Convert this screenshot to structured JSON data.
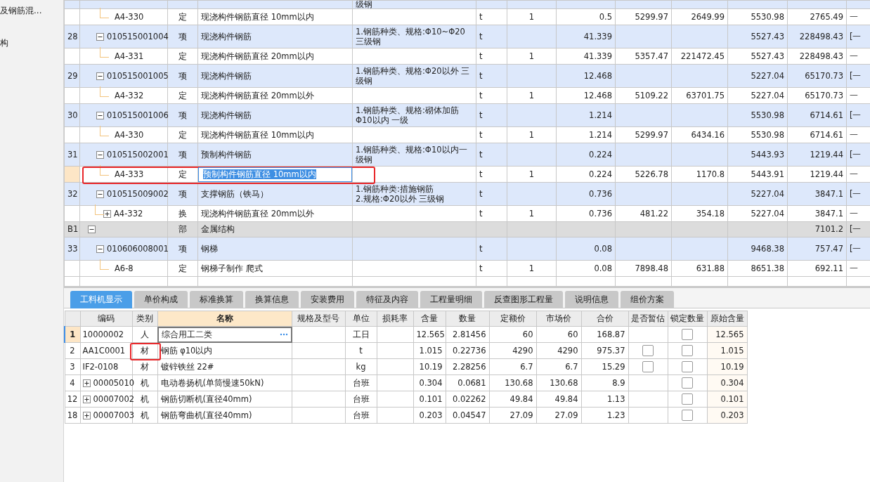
{
  "sidebar": {
    "items": [
      {
        "label": "及钢筋混..."
      },
      {
        "label": "构"
      }
    ]
  },
  "grid": {
    "rows": [
      {
        "kind": "clipped",
        "spec": [
          "级钢"
        ],
        "children": [
          {
            "kind": "quota",
            "code": "A4-330",
            "type": "定",
            "name": "现浇构件钢筋直径 10mm以内",
            "unit": "t",
            "factor": "1",
            "qty": "0.5",
            "base_price": "5299.97",
            "base_total": "2649.99",
            "unit_price": "5530.98",
            "total": "2765.49",
            "extra": "一",
            "selected": false
          }
        ]
      },
      {
        "kind": "item",
        "no": "28",
        "code": "010515001004",
        "expanded": true,
        "type": "项",
        "name": "现浇构件钢筋",
        "spec": [
          "1.钢筋种类、规格:Φ10~Φ20",
          "三级钢"
        ],
        "unit": "t",
        "qty": "41.339",
        "unit_price": "5527.43",
        "total": "228498.43",
        "extra": "[一",
        "children": [
          {
            "kind": "quota",
            "code": "A4-331",
            "type": "定",
            "name": "现浇构件钢筋直径 20mm以内",
            "unit": "t",
            "factor": "1",
            "qty": "41.339",
            "base_price": "5357.47",
            "base_total": "221472.45",
            "unit_price": "5527.43",
            "total": "228498.43",
            "extra": "一",
            "selected": false
          }
        ]
      },
      {
        "kind": "item",
        "no": "29",
        "code": "010515001005",
        "expanded": true,
        "type": "项",
        "name": "现浇构件钢筋",
        "spec": [
          "1.钢筋种类、规格:Φ20以外 三",
          "级钢"
        ],
        "unit": "t",
        "qty": "12.468",
        "unit_price": "5227.04",
        "total": "65170.73",
        "extra": "[一",
        "children": [
          {
            "kind": "quota",
            "code": "A4-332",
            "type": "定",
            "name": "现浇构件钢筋直径 20mm以外",
            "unit": "t",
            "factor": "1",
            "qty": "12.468",
            "base_price": "5109.22",
            "base_total": "63701.75",
            "unit_price": "5227.04",
            "total": "65170.73",
            "extra": "一",
            "selected": false
          }
        ]
      },
      {
        "kind": "item",
        "no": "30",
        "code": "010515001006",
        "expanded": true,
        "type": "项",
        "name": "现浇构件钢筋",
        "spec": [
          "1.钢筋种类、规格:砌体加筋",
          "Φ10以内 一级"
        ],
        "unit": "t",
        "qty": "1.214",
        "unit_price": "5530.98",
        "total": "6714.61",
        "extra": "[一",
        "children": [
          {
            "kind": "quota",
            "code": "A4-330",
            "type": "定",
            "name": "现浇构件钢筋直径 10mm以内",
            "unit": "t",
            "factor": "1",
            "qty": "1.214",
            "base_price": "5299.97",
            "base_total": "6434.16",
            "unit_price": "5530.98",
            "total": "6714.61",
            "extra": "一",
            "selected": false
          }
        ]
      },
      {
        "kind": "item",
        "no": "31",
        "code": "010515002001",
        "expanded": true,
        "type": "项",
        "name": "预制构件钢筋",
        "spec": [
          "1.钢筋种类、规格:Φ10以内一",
          "级钢"
        ],
        "unit": "t",
        "qty": "0.224",
        "unit_price": "5443.93",
        "total": "1219.44",
        "extra": "[一",
        "children": [
          {
            "kind": "quota",
            "code": "A4-333",
            "type": "定",
            "name": "预制构件钢筋直径 10mm以内",
            "unit": "t",
            "factor": "1",
            "qty": "0.224",
            "base_price": "5226.78",
            "base_total": "1170.8",
            "unit_price": "5443.91",
            "total": "1219.44",
            "extra": "一",
            "selected": true,
            "highlighted": true
          }
        ]
      },
      {
        "kind": "item",
        "no": "32",
        "code": "010515009002",
        "expanded": true,
        "type": "项",
        "name": "支撑钢筋（铁马）",
        "spec": [
          "1.钢筋种类:措施钢筋",
          "2.规格:Φ20以外 三级钢"
        ],
        "unit": "t",
        "qty": "0.736",
        "unit_price": "5227.04",
        "total": "3847.1",
        "extra": "[一",
        "children": [
          {
            "kind": "quota",
            "code": "A4-332",
            "expanded": false,
            "type": "换",
            "name": "现浇构件钢筋直径 20mm以外",
            "unit": "t",
            "factor": "1",
            "qty": "0.736",
            "base_price": "481.22",
            "base_total": "354.18",
            "unit_price": "5227.04",
            "total": "3847.1",
            "extra": "一",
            "selected": false
          }
        ]
      },
      {
        "kind": "section",
        "no": "B1",
        "expanded": true,
        "type": "部",
        "name": "金属结构",
        "total": "7101.2",
        "extra": "[一",
        "children": [
          {
            "kind": "item",
            "no": "33",
            "code": "010606008001",
            "expanded": true,
            "type": "项",
            "name": "钢梯",
            "unit": "t",
            "qty": "0.08",
            "unit_price": "9468.38",
            "total": "757.47",
            "extra": "[一",
            "children": [
              {
                "kind": "quota",
                "code": "A6-8",
                "type": "定",
                "name": "钢梯子制作 爬式",
                "unit": "t",
                "factor": "1",
                "qty": "0.08",
                "base_price": "7898.48",
                "base_total": "631.88",
                "unit_price": "8651.38",
                "total": "692.11",
                "extra": "一",
                "selected": false
              }
            ]
          }
        ]
      },
      {
        "kind": "empty"
      }
    ]
  },
  "detail_tabs": [
    {
      "label": "工料机显示",
      "selected": true
    },
    {
      "label": "单价构成",
      "selected": false
    },
    {
      "label": "标准换算",
      "selected": false
    },
    {
      "label": "换算信息",
      "selected": false
    },
    {
      "label": "安装费用",
      "selected": false
    },
    {
      "label": "特征及内容",
      "selected": false
    },
    {
      "label": "工程量明细",
      "selected": false
    },
    {
      "label": "反查图形工程量",
      "selected": false
    },
    {
      "label": "说明信息",
      "selected": false
    },
    {
      "label": "组价方案",
      "selected": false
    }
  ],
  "detail_table": {
    "columns": [
      {
        "label": "编码",
        "selected": false
      },
      {
        "label": "类别",
        "selected": false
      },
      {
        "label": "名称",
        "selected": true
      },
      {
        "label": "规格及型号",
        "selected": false
      },
      {
        "label": "单位",
        "selected": false
      },
      {
        "label": "损耗率",
        "selected": false
      },
      {
        "label": "含量",
        "selected": false
      },
      {
        "label": "数量",
        "selected": false
      },
      {
        "label": "定额价",
        "selected": false
      },
      {
        "label": "市场价",
        "selected": false
      },
      {
        "label": "合价",
        "selected": false
      },
      {
        "label": "是否暂估",
        "selected": false
      },
      {
        "label": "锁定数量",
        "selected": false
      },
      {
        "label": "原始含量",
        "selected": false
      }
    ],
    "rows": [
      {
        "no": "1",
        "code": "10000002",
        "category": "人",
        "name": "综合用工二类",
        "unit": "工日",
        "content": "12.565",
        "quantity": "2.81456",
        "base_price": "60",
        "market_price": "60",
        "total": "168.87",
        "lock_checked": false,
        "original_content": "12.565",
        "selected": true
      },
      {
        "no": "2",
        "code": "AA1C0001",
        "category": "材",
        "category_highlighted": true,
        "name": "钢筋 φ10以内",
        "unit": "t",
        "content": "1.015",
        "quantity": "0.22736",
        "base_price": "4290",
        "market_price": "4290",
        "total": "975.37",
        "provisional_checked": false,
        "lock_checked": false,
        "original_content": "1.015",
        "selected": false
      },
      {
        "no": "3",
        "code": "IF2-0108",
        "category": "材",
        "name": "镀锌铁丝 22#",
        "unit": "kg",
        "content": "10.19",
        "quantity": "2.28256",
        "base_price": "6.7",
        "market_price": "6.7",
        "total": "15.29",
        "provisional_checked": false,
        "lock_checked": false,
        "original_content": "10.19",
        "selected": false
      },
      {
        "no": "4",
        "expanded": false,
        "code": "00005010",
        "category": "机",
        "name": "电动卷扬机(单筒慢速50kN)",
        "unit": "台班",
        "content": "0.304",
        "quantity": "0.0681",
        "base_price": "130.68",
        "market_price": "130.68",
        "total": "8.9",
        "lock_checked": false,
        "original_content": "0.304",
        "selected": false
      },
      {
        "no": "12",
        "expanded": false,
        "code": "00007002",
        "category": "机",
        "name": "钢筋切断机(直径40mm)",
        "unit": "台班",
        "content": "0.101",
        "quantity": "0.02262",
        "base_price": "49.84",
        "market_price": "49.84",
        "total": "1.13",
        "lock_checked": false,
        "original_content": "0.101",
        "selected": false
      },
      {
        "no": "18",
        "expanded": false,
        "code": "00007003",
        "category": "机",
        "name": "钢筋弯曲机(直径40mm)",
        "unit": "台班",
        "content": "0.203",
        "quantity": "0.04547",
        "base_price": "27.09",
        "market_price": "27.09",
        "total": "1.23",
        "lock_checked": false,
        "original_content": "0.203",
        "selected": false
      }
    ]
  }
}
